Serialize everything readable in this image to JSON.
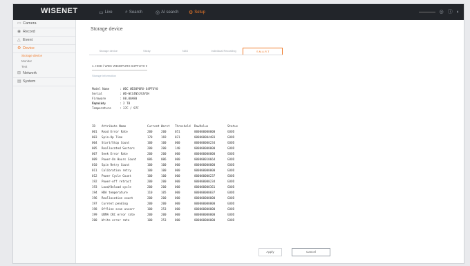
{
  "header": {
    "logo": "WISENET",
    "menu": [
      {
        "icon": "monitor-icon",
        "glyph": "▭",
        "label": "Live"
      },
      {
        "icon": "search-icon",
        "glyph": "⌕",
        "label": "Search"
      },
      {
        "icon": "ai-search-icon",
        "glyph": "◎",
        "label": "AI search"
      },
      {
        "icon": "setup-icon",
        "glyph": "⚙",
        "label": "Setup"
      }
    ],
    "right_icons": [
      "notification-icon",
      "help-icon",
      "user-icon"
    ]
  },
  "sidebar": {
    "items": [
      {
        "icon": "camera-icon",
        "glyph": "▭",
        "label": "Camera"
      },
      {
        "icon": "record-icon",
        "glyph": "◉",
        "label": "Record"
      },
      {
        "icon": "event-icon",
        "glyph": "△",
        "label": "Event"
      },
      {
        "icon": "device-icon",
        "glyph": "⚙",
        "label": "Device"
      }
    ],
    "sub_items": [
      "Storage device",
      "Monitor",
      "Text"
    ],
    "items2": [
      {
        "icon": "network-icon",
        "glyph": "⊞",
        "label": "Network"
      },
      {
        "icon": "system-icon",
        "glyph": "▤",
        "label": "System"
      }
    ]
  },
  "main": {
    "title": "Storage device",
    "tabs": [
      "Storage device",
      "Sticky",
      "NAS",
      "Individual Recording",
      "S.M.A.R.T"
    ],
    "device_select": "1. HDD / WDC WD30PURX-64PFUY0 ▾",
    "device_sub": "Storage information",
    "info": [
      {
        "k": "Model Name",
        "v": ": WDC WD30PURX-64PFUY0"
      },
      {
        "k": "Serial",
        "v": ": WD-WCC4N5J9JV3H"
      },
      {
        "k": "Firmware Version",
        "v": ": 80.00A80"
      },
      {
        "k": "Capacity",
        "v": ": 2 TB"
      },
      {
        "k": "Temperature",
        "v": ": 37C / 97F"
      }
    ],
    "smart_headers": [
      "ID",
      "Attribute Name",
      "Current",
      "Worst",
      "Threshold",
      "RawValue",
      "Status"
    ],
    "smart_rows": [
      [
        "001",
        "Read Error Rate",
        "200",
        "200",
        "051",
        "000000000000",
        "GOOD"
      ],
      [
        "003",
        "Spin-Up Time",
        "170",
        "169",
        "021",
        "000000004483",
        "GOOD"
      ],
      [
        "004",
        "Start/Stop Count",
        "100",
        "100",
        "000",
        "000000000234",
        "GOOD"
      ],
      [
        "005",
        "Reallocated Sectors",
        "200",
        "200",
        "140",
        "000000000000",
        "GOOD"
      ],
      [
        "007",
        "Seek Error Rate",
        "200",
        "200",
        "000",
        "000000000000",
        "GOOD"
      ],
      [
        "009",
        "Power-On Hours Count",
        "086",
        "086",
        "000",
        "000000010664",
        "GOOD"
      ],
      [
        "010",
        "Spin Retry Count",
        "100",
        "100",
        "000",
        "000000000000",
        "GOOD"
      ],
      [
        "011",
        "Calibration retry",
        "100",
        "100",
        "000",
        "000000000000",
        "GOOD"
      ],
      [
        "012",
        "Power Cycle Count",
        "100",
        "100",
        "000",
        "000000000237",
        "GOOD"
      ],
      [
        "192",
        "Power-off retract",
        "200",
        "200",
        "000",
        "000000000234",
        "GOOD"
      ],
      [
        "193",
        "Load/Unload cycle",
        "200",
        "200",
        "000",
        "000000000361",
        "GOOD"
      ],
      [
        "194",
        "HDA temperature",
        "110",
        "105",
        "000",
        "000000000037",
        "GOOD"
      ],
      [
        "196",
        "Reallocation count",
        "200",
        "200",
        "000",
        "000000000000",
        "GOOD"
      ],
      [
        "197",
        "Current pending",
        "200",
        "200",
        "000",
        "000000000000",
        "GOOD"
      ],
      [
        "198",
        "Offline scan uncorr",
        "100",
        "253",
        "000",
        "000000000000",
        "GOOD"
      ],
      [
        "199",
        "UDMA CRC error rate",
        "200",
        "200",
        "000",
        "000000000000",
        "GOOD"
      ],
      [
        "200",
        "Write error rate",
        "100",
        "253",
        "000",
        "000000000000",
        "GOOD"
      ]
    ],
    "buttons": {
      "apply": "Apply",
      "cancel": "Cancel"
    }
  },
  "colors": {
    "accent": "#f07a29",
    "topbar": "#22252a"
  }
}
